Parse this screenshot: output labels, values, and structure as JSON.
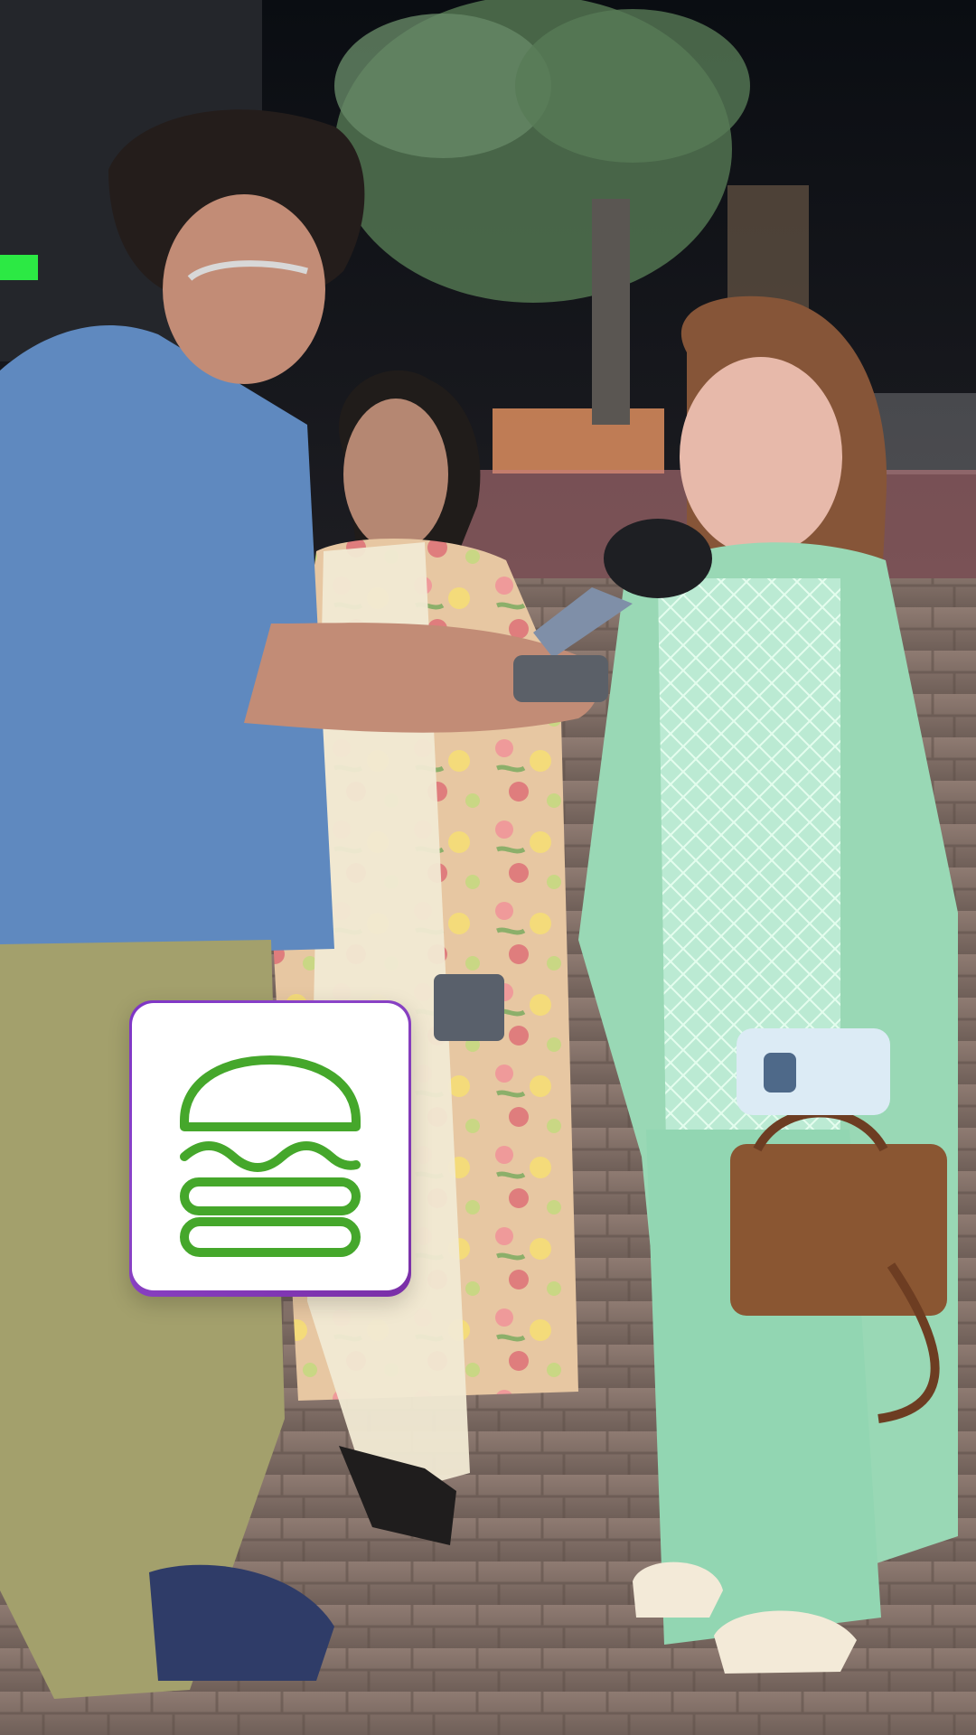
{
  "scene": {
    "type": "street-interview-photo",
    "logo_icon": "burger-icon",
    "colors": {
      "logo_green": "#45a72b",
      "logo_border": "#8b44c9",
      "shirt_blue": "#5f89bf",
      "mint_outfit": "#9fdcbc"
    }
  }
}
